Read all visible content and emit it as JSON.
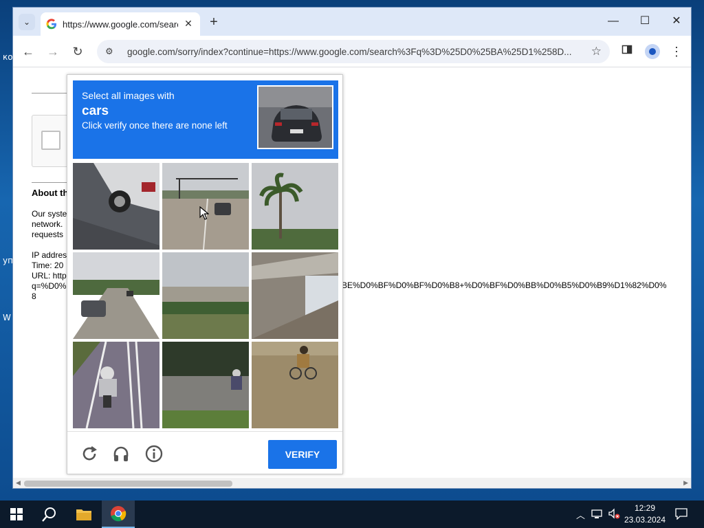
{
  "desktop": {
    "labels": [
      "ко",
      "уп",
      "W"
    ]
  },
  "browser": {
    "tab_title": "https://www.google.com/search",
    "url": "google.com/sorry/index?continue=https://www.google.com/search%3Fq%3D%25D0%25BA%25D1%258D..."
  },
  "page": {
    "about_heading": "About th",
    "para1": [
      "Our syste",
      "network.",
      "requests"
    ],
    "ip_line": "IP addres",
    "time_line": "Time: 20",
    "url_line": "URL: http",
    "q_line": "q=%D0%",
    "num_line": "8",
    "long_url_tail": "BE%D0%BF%D0%BF%D0%B8+%D0%BF%D0%BB%D0%B5%D0%B9%D1%82%D0%"
  },
  "captcha": {
    "line1": "Select all images with",
    "target": "cars",
    "line3": "Click verify once there are none left",
    "verify_label": "VERIFY",
    "tiles": [
      "truck",
      "road-car",
      "palm-tree",
      "road-car-2",
      "grass-road",
      "bridge",
      "motorcycle",
      "scooter",
      "cyclist"
    ]
  },
  "taskbar": {
    "time": "12:29",
    "date": "23.03.2024"
  }
}
